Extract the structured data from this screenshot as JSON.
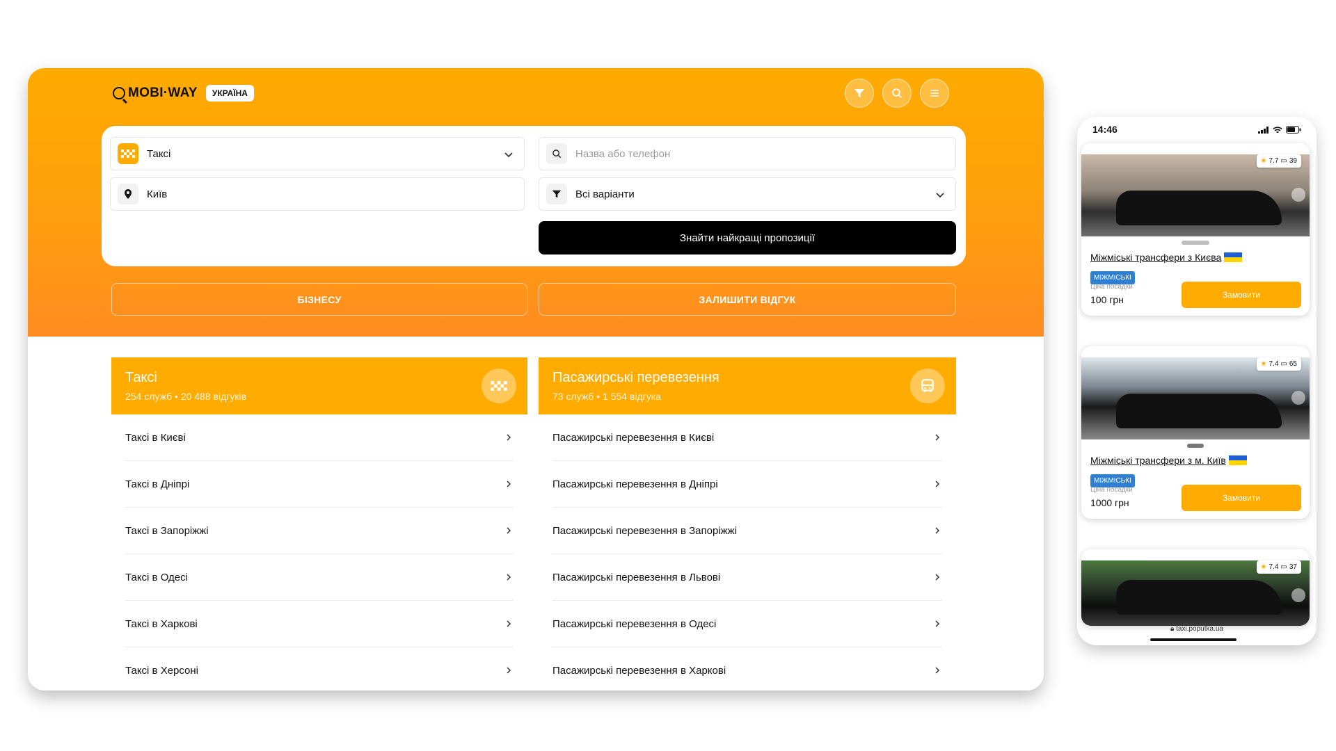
{
  "header": {
    "logo_text": "MOBI·WAY",
    "country": "УКРАЇНА",
    "icons": [
      "filter-icon",
      "search-icon",
      "menu-icon"
    ]
  },
  "search": {
    "category_value": "Таксі",
    "city_value": "Київ",
    "name_placeholder": "Назва або телефон",
    "filter_value": "Всі варіанти",
    "find_label": "Знайти найкращі пропозиції"
  },
  "actions": {
    "business_label": "БІЗНЕСУ",
    "review_label": "ЗАЛИШИТИ ВІДГУК"
  },
  "categories": [
    {
      "title": "Таксі",
      "services": "254 служб",
      "reviews": "20 488 відгуків",
      "icon": "taxi-icon",
      "items": [
        "Таксі в Києві",
        "Таксі в Дніпрі",
        "Таксі в Запоріжжі",
        "Таксі в Одесі",
        "Таксі в Харкові",
        "Таксі в Херсоні"
      ]
    },
    {
      "title": "Пасажирські перевезення",
      "services": "73 служб",
      "reviews": "1 554 відгука",
      "icon": "bus-icon",
      "items": [
        "Пасажирські перевезення в Києві",
        "Пасажирські перевезення в Дніпрі",
        "Пасажирські перевезення в Запоріжжі",
        "Пасажирські перевезення в Львові",
        "Пасажирські перевезення в Одесі",
        "Пасажирські перевезення в Харкові"
      ]
    }
  ],
  "phone": {
    "time": "14:46",
    "url": "taxi.poputka.ua",
    "cards": [
      {
        "rating": "7.7",
        "comments": "39",
        "title": "Міжміські трансфери з Києва",
        "tag": "МІЖМІСЬКІ",
        "price_label": "Ціна посадки",
        "price": "100 грн",
        "order_label": "Замовити"
      },
      {
        "rating": "7.4",
        "comments": "65",
        "title": "Міжміські трансфери з м. Київ",
        "tag": "МІЖМІСЬКІ",
        "price_label": "Ціна посадки",
        "price": "1000 грн",
        "order_label": "Замовити"
      },
      {
        "rating": "7.4",
        "comments": "37"
      }
    ]
  },
  "colors": {
    "accent": "#ffab00",
    "accent_dark": "#ff8c22",
    "button_dark": "#000000",
    "tag_blue": "#2f7fd3"
  }
}
